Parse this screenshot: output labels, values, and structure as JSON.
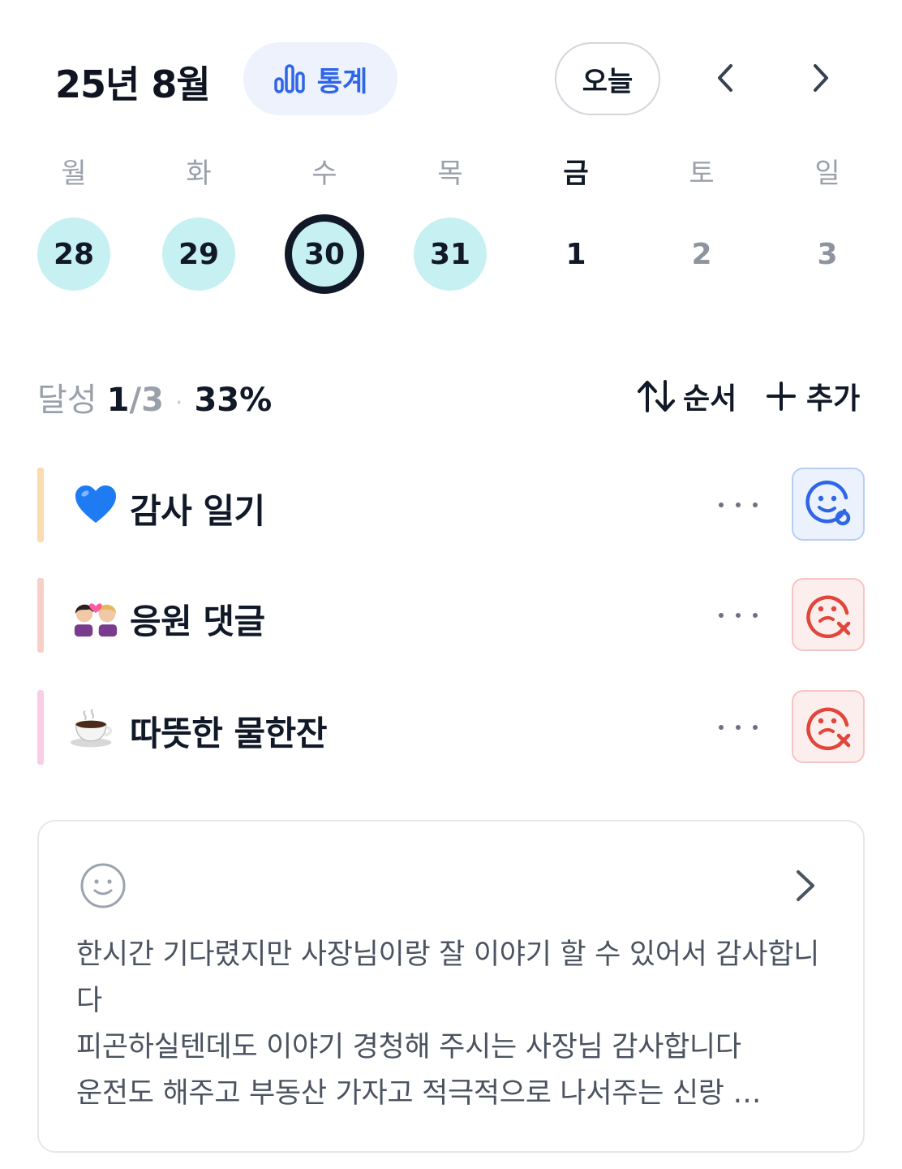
{
  "header": {
    "month_title": "25년 8월",
    "stats_label": "통계",
    "today_label": "오늘"
  },
  "week": {
    "weekdays": [
      "월",
      "화",
      "수",
      "목",
      "금",
      "토",
      "일"
    ],
    "days": [
      "28",
      "29",
      "30",
      "31",
      "1",
      "2",
      "3"
    ]
  },
  "progress": {
    "label": "달성",
    "done": "1",
    "total": "/3",
    "separator": "·",
    "percent": "33%"
  },
  "actions": {
    "sort_label": "순서",
    "add_label": "추가"
  },
  "habits": [
    {
      "emoji": "💙",
      "name": "감사 일기",
      "bar_color": "#f9dcb0",
      "status": "done"
    },
    {
      "emoji": "💏",
      "name": "응원 댓글",
      "bar_color": "#f7cfc8",
      "status": "failed"
    },
    {
      "emoji": "☕",
      "name": "따뜻한 물한잔",
      "bar_color": "#f9cde6",
      "status": "failed"
    }
  ],
  "journal": {
    "text": "한시간 기다렸지만 사장님이랑 잘 이야기 할 수 있어서 감사합니다\n피곤하실텐데도 이야기 경청해 주시는 사장님 감사합니다\n운전도 해주고 부동산 가자고 적극적으로 나서주는 신랑 …"
  },
  "colors": {
    "accent_blue": "#2f66e8",
    "done_day": "#c6f0f2",
    "fail_red": "#e0473a"
  }
}
